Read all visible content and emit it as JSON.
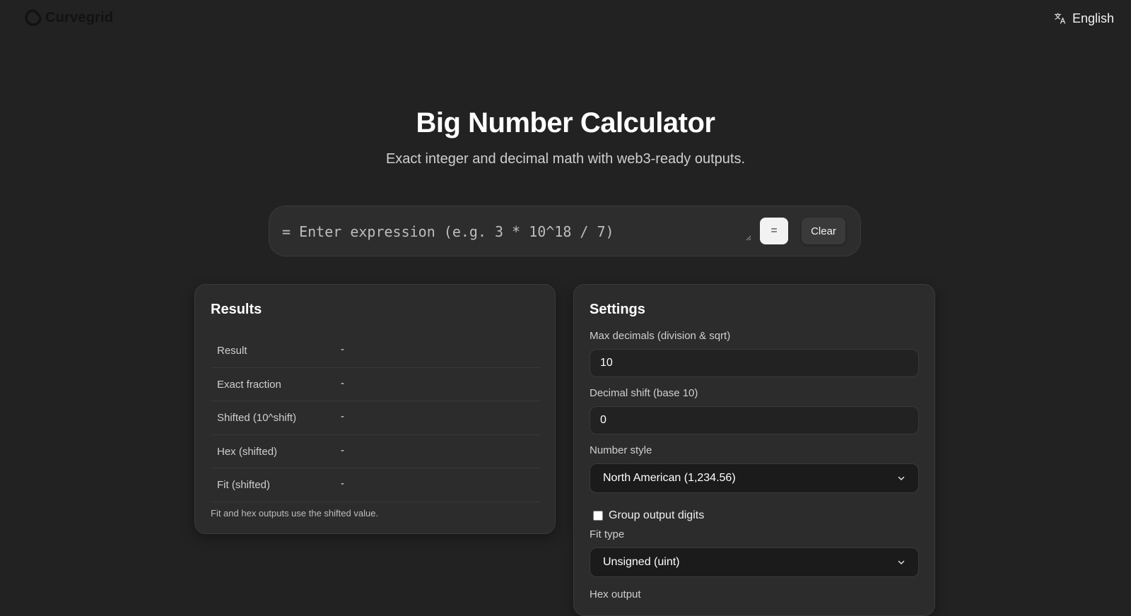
{
  "header": {
    "brand": "Curvegrid",
    "language": "English",
    "icons": {
      "logo": "curvegrid-logo-icon",
      "language": "translate-icon"
    }
  },
  "hero": {
    "title": "Big Number Calculator",
    "subtitle": "Exact integer and decimal math with web3-ready outputs."
  },
  "expression": {
    "placeholder": "= Enter expression (e.g. 3 * 10^18 / 7)",
    "value": "",
    "equals_label": "=",
    "clear_label": "Clear"
  },
  "results": {
    "title": "Results",
    "rows": [
      {
        "label": "Result",
        "value": "-"
      },
      {
        "label": "Exact fraction",
        "value": "-"
      },
      {
        "label": "Shifted (10^shift)",
        "value": "-"
      },
      {
        "label": "Hex (shifted)",
        "value": "-"
      },
      {
        "label": "Fit (shifted)",
        "value": "-"
      }
    ],
    "note": "Fit and hex outputs use the shifted value."
  },
  "settings": {
    "title": "Settings",
    "max_decimals": {
      "label": "Max decimals (division & sqrt)",
      "value": "10"
    },
    "decimal_shift": {
      "label": "Decimal shift (base 10)",
      "value": "0"
    },
    "number_style": {
      "label": "Number style",
      "selected": "North American (1,234.56)"
    },
    "group_digits": {
      "label": "Group output digits",
      "checked": false
    },
    "fit_type": {
      "label": "Fit type",
      "selected": "Unsigned (uint)"
    },
    "hex_output": {
      "label": "Hex output"
    }
  },
  "colors": {
    "background": "#222222",
    "card": "#2c2c2c",
    "text": "#ffffff",
    "muted": "#cfcfcf",
    "accent_button": "#f2f2f2"
  }
}
